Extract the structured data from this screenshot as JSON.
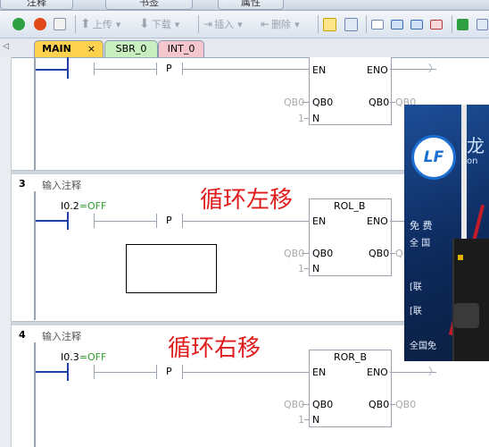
{
  "top_tabs": [
    "注释",
    "书签",
    "属性"
  ],
  "toolbar": {
    "upload": "上传",
    "download": "下载",
    "insert": "插入",
    "delete": "删除"
  },
  "editor_tabs": [
    {
      "label": "MAIN",
      "close": "×",
      "color": "#ffd24d"
    },
    {
      "label": "SBR_0",
      "color": "#c9efc0"
    },
    {
      "label": "INT_0",
      "color": "#f6c6cf"
    }
  ],
  "colors": {
    "accent_red": "#e01b1b",
    "contact_blue": "#1f3fa6"
  },
  "rung2": {
    "pulse": "P",
    "en": "EN",
    "eno": "ENO",
    "in_pin": "QB0",
    "out_pin": "QB0",
    "in_val": "QB0",
    "out_val": "QB0",
    "n_pin": "N",
    "n_val": "1"
  },
  "rung3": {
    "number": "3",
    "comment": "输入注释",
    "contact": "I0.2",
    "state": "=OFF",
    "pulse": "P",
    "block": "ROL_B",
    "en": "EN",
    "eno": "ENO",
    "in_pin": "QB0",
    "out_pin": "QB0",
    "in_val": "QB0",
    "out_val": "Q",
    "n_pin": "N",
    "n_val": "1",
    "overlay_title": "循环左移"
  },
  "rung4": {
    "number": "4",
    "comment": "输入注释",
    "contact": "I0.3",
    "state": "=OFF",
    "pulse": "P",
    "block": "ROR_B",
    "en": "EN",
    "eno": "ENO",
    "in_pin": "QB0",
    "out_pin": "QB0",
    "in_val": "QB0",
    "out_val": "QB0",
    "n_pin": "N",
    "n_val": "1",
    "overlay_title": "循环右移"
  },
  "video": {
    "logo": "LF",
    "lines": [
      "免 费",
      "全 国",
      "[联",
      "[联",
      "全国免"
    ]
  }
}
